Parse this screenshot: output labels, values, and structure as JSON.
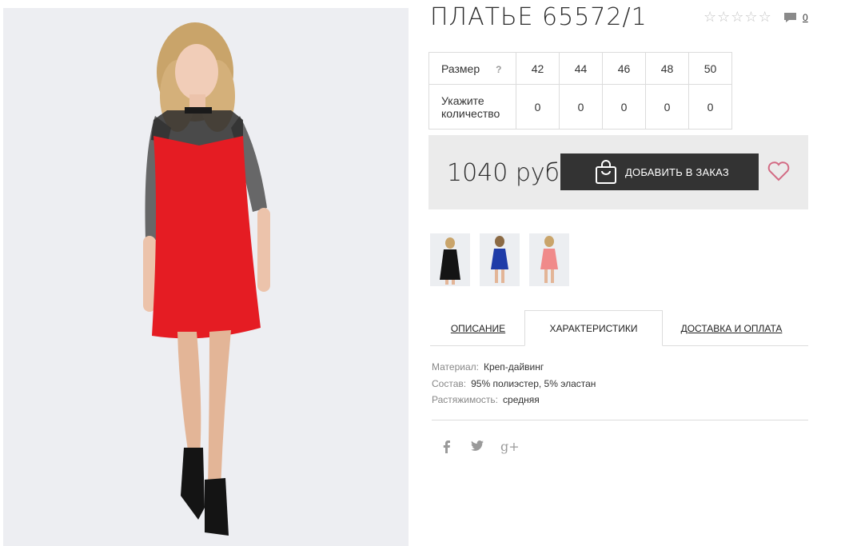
{
  "product": {
    "title": "ПЛАТЬЕ 65572/1",
    "rating_stars": 5,
    "comment_count": "0"
  },
  "size_table": {
    "size_label": "Размер",
    "help_glyph": "?",
    "sizes": [
      "42",
      "44",
      "46",
      "48",
      "50"
    ],
    "qty_label_line1": "Укажите",
    "qty_label_line2": "количество",
    "quantities": [
      "0",
      "0",
      "0",
      "0",
      "0"
    ]
  },
  "price": {
    "value": "1040 руб",
    "add_button_label": "ДОБАВИТЬ В ЗАКАЗ"
  },
  "thumbnails": [
    {
      "color": "black-dress"
    },
    {
      "color": "blue-dress"
    },
    {
      "color": "pink-dress"
    }
  ],
  "tabs": [
    {
      "label": "ОПИСАНИЕ"
    },
    {
      "label": "ХАРАКТЕРИСТИКИ"
    },
    {
      "label": "ДОСТАВКА И ОПЛАТА"
    }
  ],
  "characteristics": [
    {
      "name": "Материал:",
      "value": "Креп-дайвинг"
    },
    {
      "name": "Состав:",
      "value": "95% полиэстер, 5% эластан"
    },
    {
      "name": "Растяжимость:",
      "value": "средняя"
    }
  ],
  "social": [
    "f",
    "twitter",
    "g+"
  ],
  "colors": {
    "button_bg": "#333333",
    "panel_bg": "#ebebeb",
    "heart": "#d36b84",
    "dress_main": "#e51c23"
  }
}
